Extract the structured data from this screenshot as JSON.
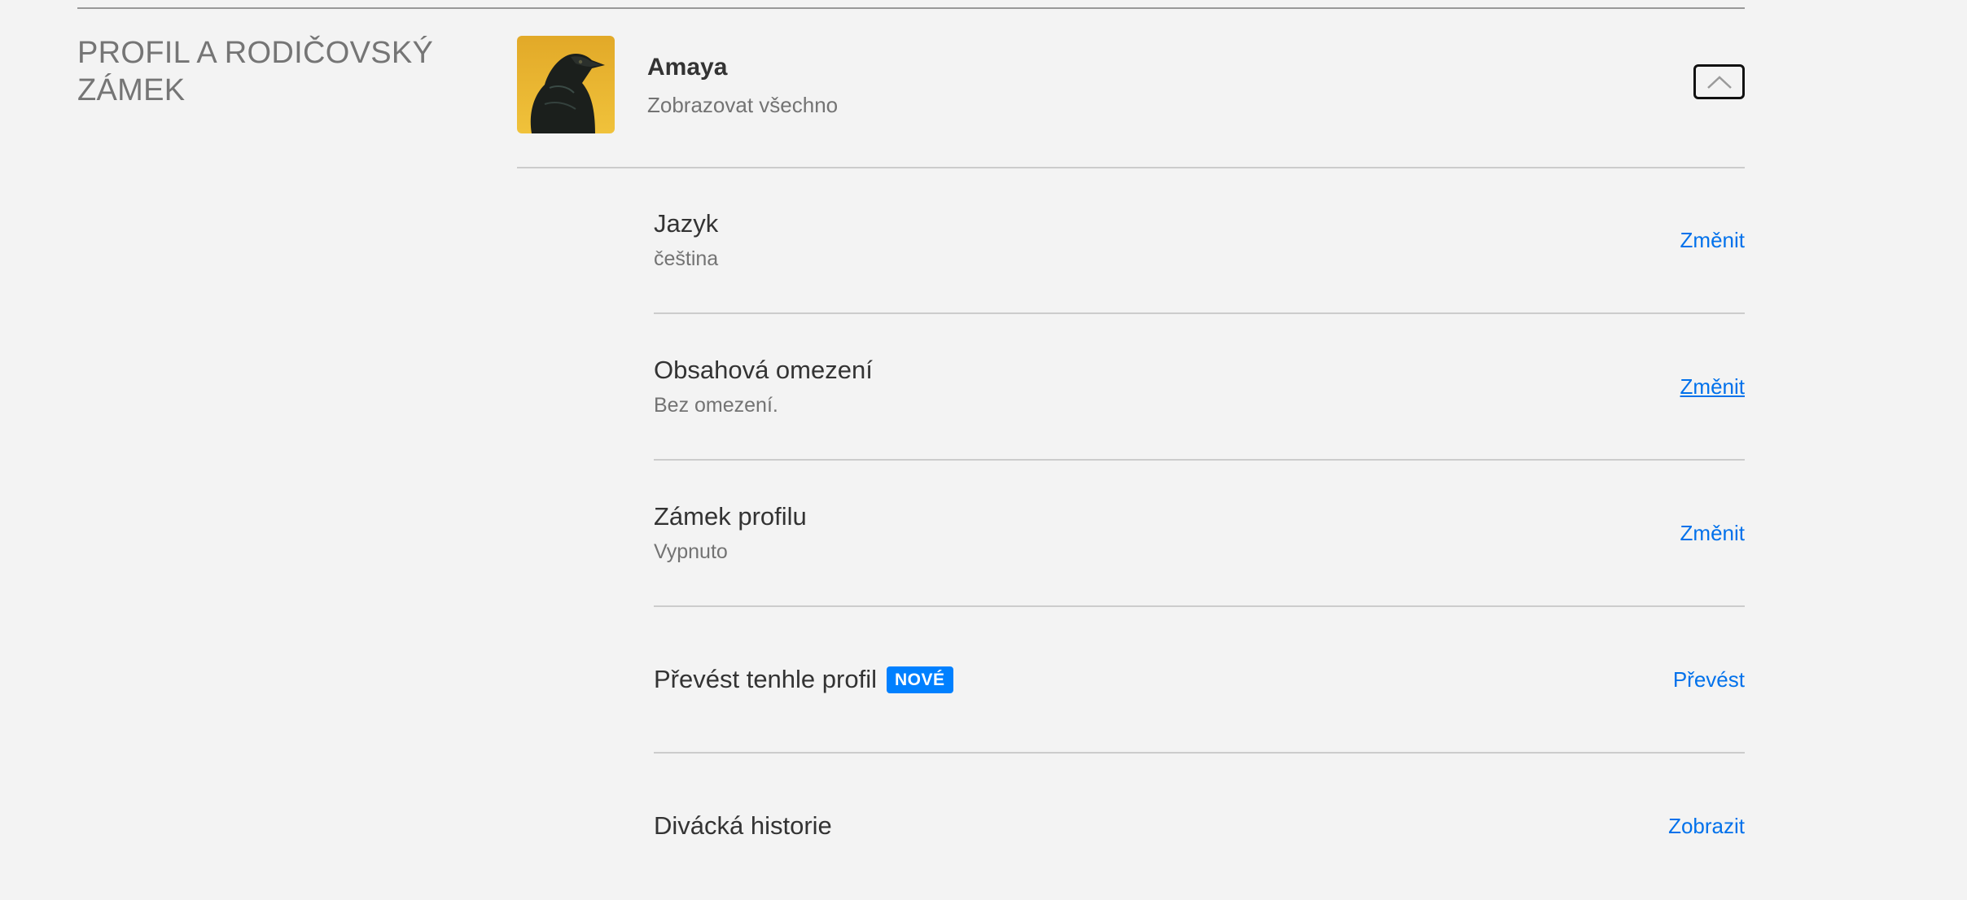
{
  "section": {
    "title": "PROFIL A RODIČOVSKÝ ZÁMEK"
  },
  "profile": {
    "name": "Amaya",
    "subtitle": "Zobrazovat všechno",
    "avatar_icon": "raven-avatar",
    "avatar_background": "#e8b52e",
    "collapse_icon": "chevron-up-icon"
  },
  "settings": [
    {
      "title": "Jazyk",
      "value": "čeština",
      "action": "Změnit"
    },
    {
      "title": "Obsahová omezení",
      "value": "Bez omezení.",
      "action": "Změnit"
    },
    {
      "title": "Zámek profilu",
      "value": "Vypnuto",
      "action": "Změnit"
    },
    {
      "title": "Převést tenhle profil",
      "badge": "NOVÉ",
      "action": "Převést"
    },
    {
      "title": "Divácká historie",
      "action": "Zobrazit"
    }
  ],
  "colors": {
    "link": "#0071eb",
    "badge": "#0080ff",
    "background": "#f3f3f3"
  }
}
